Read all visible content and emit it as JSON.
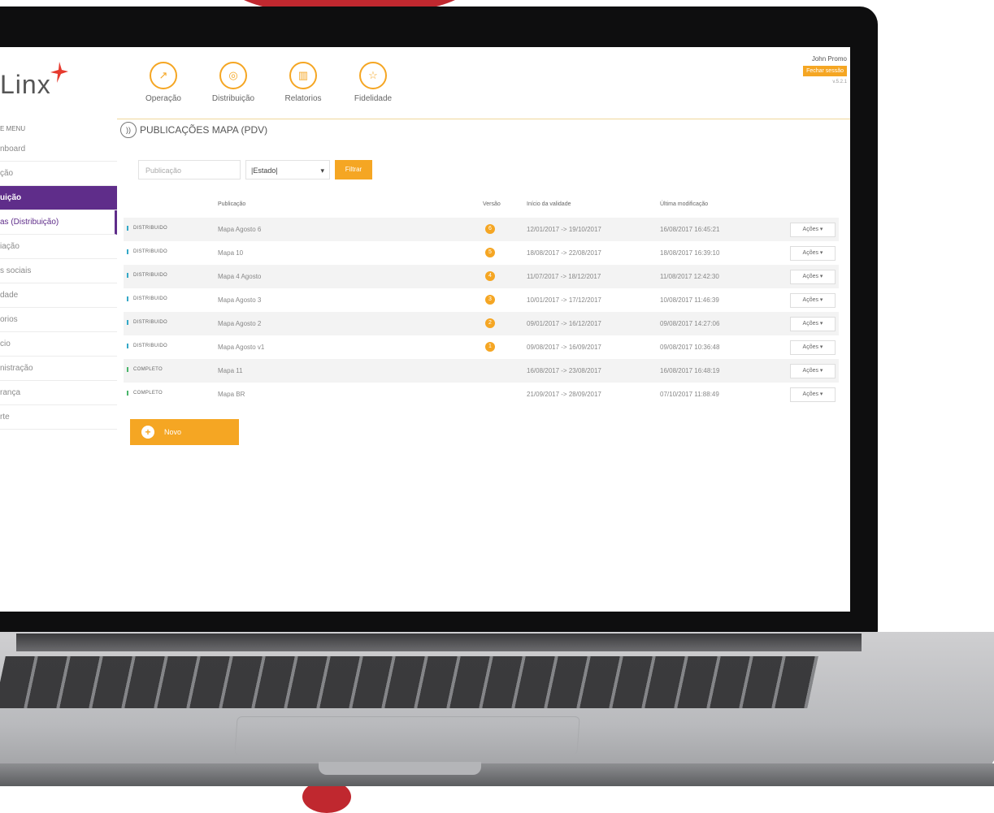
{
  "app": {
    "logo_text": "Linx",
    "nav": [
      {
        "label": "Operação",
        "icon": "chart-line-icon"
      },
      {
        "label": "Distribuição",
        "icon": "location-pin-icon"
      },
      {
        "label": "Relatorios",
        "icon": "bar-chart-icon"
      },
      {
        "label": "Fidelidade",
        "icon": "star-icon"
      }
    ],
    "user": {
      "name": "John Promo",
      "logout": "Fechar sessão",
      "version": "v.5.2.1"
    },
    "sidebar": {
      "header": "E MENU",
      "items": [
        {
          "label": "nboard",
          "state": "normal"
        },
        {
          "label": "ção",
          "state": "normal"
        },
        {
          "label": "uição",
          "state": "active"
        },
        {
          "label": "as (Distribuição)",
          "state": "sub"
        },
        {
          "label": "iação",
          "state": "normal"
        },
        {
          "label": "s sociais",
          "state": "normal"
        },
        {
          "label": "dade",
          "state": "normal"
        },
        {
          "label": "orios",
          "state": "normal"
        },
        {
          "label": "cio",
          "state": "normal"
        },
        {
          "label": "nistração",
          "state": "normal"
        },
        {
          "label": "rança",
          "state": "normal"
        },
        {
          "label": "rte",
          "state": "normal"
        }
      ]
    },
    "page_title": "PUBLICAÇÕES MAPA (PDV)",
    "filters": {
      "pub_placeholder": "Publicação",
      "estado_value": "|Estado|",
      "filter_button": "Filtrar"
    },
    "table": {
      "headers": [
        "Publicação",
        "Versão",
        "Início da validade",
        "Última modificação"
      ],
      "rows": [
        {
          "status": "DISTRIBUIDO",
          "name": "Mapa Agosto 6",
          "version": "6",
          "validity": "12/01/2017 -> 19/10/2017",
          "modified": "16/08/2017 16:45:21",
          "action": "Ações ▾"
        },
        {
          "status": "DISTRIBUIDO",
          "name": "Mapa 10",
          "version": "5",
          "validity": "18/08/2017 -> 22/08/2017",
          "modified": "18/08/2017 16:39:10",
          "action": "Ações ▾"
        },
        {
          "status": "DISTRIBUIDO",
          "name": "Mapa 4 Agosto",
          "version": "4",
          "validity": "11/07/2017 -> 18/12/2017",
          "modified": "11/08/2017 12:42:30",
          "action": "Ações ▾"
        },
        {
          "status": "DISTRIBUIDO",
          "name": "Mapa Agosto 3",
          "version": "3",
          "validity": "10/01/2017 -> 17/12/2017",
          "modified": "10/08/2017 11:46:39",
          "action": "Ações ▾"
        },
        {
          "status": "DISTRIBUIDO",
          "name": "Mapa Agosto 2",
          "version": "2",
          "validity": "09/01/2017 -> 16/12/2017",
          "modified": "09/08/2017 14:27:06",
          "action": "Ações ▾"
        },
        {
          "status": "DISTRIBUIDO",
          "name": "Mapa Agosto v1",
          "version": "1",
          "validity": "09/08/2017 -> 16/09/2017",
          "modified": "09/08/2017 10:36:48",
          "action": "Ações ▾"
        },
        {
          "status": "COMPLETO",
          "name": "Mapa 11",
          "version": "",
          "validity": "16/08/2017 -> 23/08/2017",
          "modified": "16/08/2017 16:48:19",
          "action": "Ações ▾"
        },
        {
          "status": "COMPLETO",
          "name": "Mapa BR",
          "version": "",
          "validity": "21/09/2017 -> 28/09/2017",
          "modified": "07/10/2017 11:88:49",
          "action": "Ações ▾"
        }
      ]
    },
    "new_button": "Novo"
  }
}
